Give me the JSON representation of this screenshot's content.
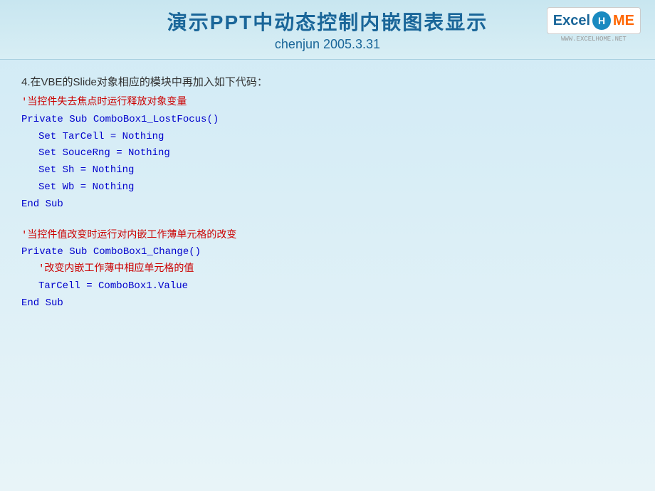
{
  "header": {
    "title": "演示PPT中动态控制内嵌图表显示",
    "subtitle": "chenjun   2005.3.31",
    "logo": {
      "excel": "Excel",
      "home": "H ME",
      "url": "WWW.EXCELHOME.NET"
    }
  },
  "content": {
    "section_title": "4.在VBE的Slide对象相应的模块中再加入如下代码：",
    "block1": {
      "comment1": "'当控件失去焦点时运行释放对象变量",
      "line1": "Private Sub ComboBox1_LostFocus()",
      "line2": "    Set TarCell = Nothing",
      "line3": "    Set SouceRng  = Nothing",
      "line4": "    Set Sh = Nothing",
      "line5": "    Set Wb = Nothing",
      "line6": "End Sub"
    },
    "block2": {
      "comment1": "'当控件值改变时运行对内嵌工作薄单元格的改变",
      "line1": "Private Sub ComboBox1_Change()",
      "line2": "    '改变内嵌工作薄中相应单元格的值",
      "line3": "    TarCell = ComboBox1.Value",
      "line4": "End Sub"
    }
  }
}
